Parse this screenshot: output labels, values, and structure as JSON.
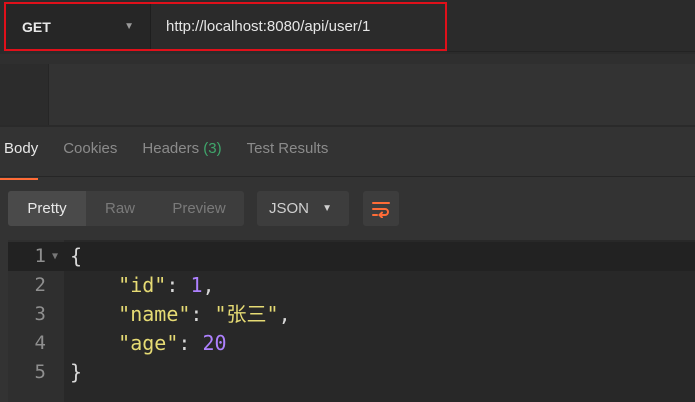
{
  "request": {
    "method": "GET",
    "url": "http://localhost:8080/api/user/1"
  },
  "tabs": [
    {
      "label": "Body"
    },
    {
      "label": "Cookies"
    },
    {
      "label": "Headers",
      "count": "(3)"
    },
    {
      "label": "Test Results"
    }
  ],
  "view_modes": [
    "Pretty",
    "Raw",
    "Preview"
  ],
  "format": "JSON",
  "response_lines": [
    {
      "n": "1",
      "open": "{"
    },
    {
      "n": "2",
      "key": "\"id\"",
      "colon": ": ",
      "value": "1",
      "trail": ","
    },
    {
      "n": "3",
      "key": "\"name\"",
      "colon": ": ",
      "value": "\"张三\"",
      "trail": ","
    },
    {
      "n": "4",
      "key": "\"age\"",
      "colon": ": ",
      "value": "20",
      "trail": ""
    },
    {
      "n": "5",
      "close": "}"
    }
  ],
  "colors": {
    "highlight": "#e0101a",
    "accent": "#ff6c37",
    "json_key": "#e6db74",
    "json_number": "#ae81ff"
  },
  "icons": {
    "wrap": "wrap-lines-icon",
    "caret": "chevron-down-icon"
  }
}
